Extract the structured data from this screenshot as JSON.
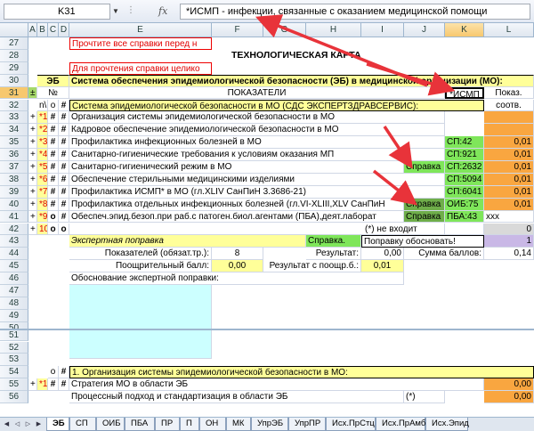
{
  "formula_bar": {
    "name_box": "K31",
    "fx_label": "fx",
    "content": "*ИСМП - инфекции, связанные с оказанием медицинской помощи"
  },
  "heading": "ТЕХНОЛОГИЧЕСКАЯ КАРТА",
  "columns": [
    "A",
    "B",
    "C",
    "D",
    "E",
    "F",
    "G",
    "H",
    "I",
    "J",
    "K",
    "L"
  ],
  "selected_column": "K",
  "rows_top": [
    "27",
    "28",
    "29",
    "30",
    "31",
    "32",
    "33",
    "34",
    "35",
    "36",
    "37",
    "38",
    "39",
    "40",
    "41",
    "42",
    "43",
    "44",
    "45",
    "46",
    "47",
    "48",
    "49",
    "50",
    "51",
    "52",
    "53",
    "54",
    "55",
    "56"
  ],
  "selected_row": "31",
  "cells": {
    "r27_note": "Прочтите все справки перед н",
    "r29_note": "Для прочтения справки целико",
    "r30_eb": "ЭБ",
    "r30_title": "Система обеспечения эпидемиологической безопасности (ЭБ) в медицинской организации (МО):",
    "r31_marker": "±",
    "r31_no": "№",
    "r31_pokaz": "ПОКАЗАТЕЛИ",
    "r31_ismp": "*ИСМП",
    "r31_pokaz2": "Показ.",
    "r32_np": "n\\n",
    "r32_o": "o",
    "r32_sign": "#",
    "r32_title": "Система эпидемиологической безопасности в МО (СДС ЭКСПЕРТЗДРАВСЕРВИС):",
    "r32_soot": "соотв.",
    "items": [
      {
        "plus": "+",
        "num": "*1",
        "a": "#",
        "b": "#",
        "text": "Организация системы эпидемиологической безопасности в МО",
        "k": "",
        "l": ""
      },
      {
        "plus": "+",
        "num": "*2",
        "a": "#",
        "b": "#",
        "text": "Кадровое обеспечение эпидемиологической безопасности в МО",
        "k": "",
        "l": ""
      },
      {
        "plus": "+",
        "num": "*3",
        "a": "#",
        "b": "#",
        "text": "Профилактика инфекционных болезней в МО",
        "k": "СП:42",
        "l": "0,01"
      },
      {
        "plus": "+",
        "num": "*4",
        "a": "#",
        "b": "#",
        "text": "Санитарно-гигиенические требования к условиям оказания МП",
        "k": "СП:921",
        "l": "0,01"
      },
      {
        "plus": "+",
        "num": "*5",
        "a": "#",
        "b": "#",
        "text": "Санитарно-гигиенический режим в МО",
        "j": "Справка",
        "k": "СП:2632",
        "l": "0,01"
      },
      {
        "plus": "+",
        "num": "*6",
        "a": "#",
        "b": "#",
        "text": "Обеспечение стерильными медицинскими изделиями",
        "k": "СП:5094",
        "l": "0,01"
      },
      {
        "plus": "+",
        "num": "*7",
        "a": "#",
        "b": "#",
        "text": "Профилактика ИСМП* в МО (гл.XLIV СанПиН 3.3686-21)",
        "k": "СП:6041",
        "l": "0,01"
      },
      {
        "plus": "+",
        "num": "*8",
        "a": "#",
        "b": "#",
        "text": "Профилактика отдельных инфекционных болезней (гл.VI-XLIII,XLV СанПиН",
        "j": "Справка",
        "k": "ОИБ:75",
        "l": "0,01"
      },
      {
        "plus": "+",
        "num": "*9",
        "a": "o",
        "b": "#",
        "text": "Обеспеч.эпид.безоп.при раб.с патоген.биол.агентами (ПБА),деят.лаборат",
        "j": "Справка",
        "k": "ПБА:43",
        "l": "xxx"
      },
      {
        "plus": "+",
        "num": "10",
        "a": "o",
        "b": "o",
        "text": "",
        "j": "",
        "k": "",
        "l": "0"
      }
    ],
    "r42_note": "(*) не входит",
    "r43_expert": "Экспертная поправка",
    "r43_sprav": "Справка.",
    "r43_popr": "Поправку обосновать!",
    "r43_val": "1",
    "r44_pokaz": "Показателей (обязат.тр.):",
    "r44_count": "8",
    "r44_result": "Результат:",
    "r44_result_val": "0,00",
    "r44_sum": "Сумма баллов:",
    "r44_sum_val": "0,14",
    "r45_poshchr": "Поощрительный балл:",
    "r45_poshchr_val": "0,00",
    "r45_res2": "Результат с поощр.б.:",
    "r45_res2_val": "0,01",
    "r46_obosn": "Обоснование экспертной поправки:",
    "r54_o": "o",
    "r54_sign": "#",
    "r54_title": "1.  Организация системы эпидемиологической безопасности в МО:",
    "r55_num": "*1",
    "r55_text": "Стратегия МО в области ЭБ",
    "r55_val": "0,00",
    "r56_text": "Процессный подход и стандартизация в области ЭБ",
    "r56_note": "(*)",
    "r56_val": "0,00"
  },
  "sheet_tabs": [
    "ЭБ",
    "СП",
    "ОИБ",
    "ПБА",
    "ПР",
    "П",
    "ОН",
    "МК",
    "УпрЭБ",
    "УпрПР",
    "Исх.ПрСтц",
    "Исх.ПрАмб",
    "Исх.Эпид"
  ],
  "active_tab": "ЭБ"
}
